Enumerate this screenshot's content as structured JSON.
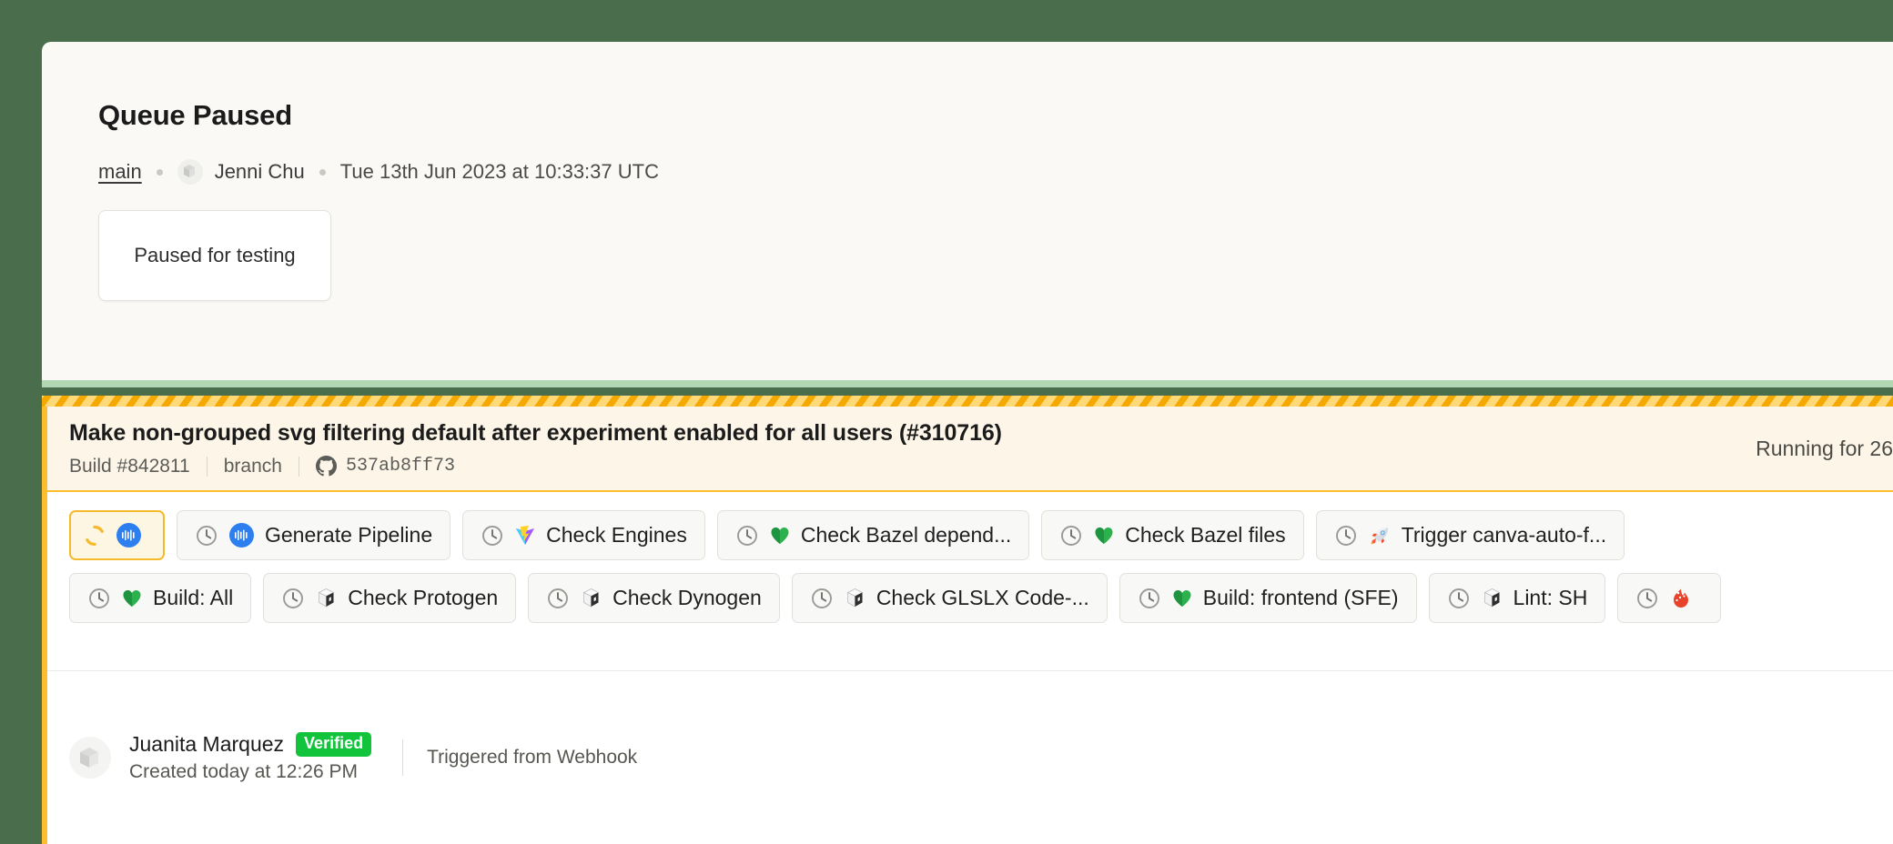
{
  "theme": {
    "page_bg": "#4a6e4c",
    "card_bg": "#faf9f5",
    "accent_yellow": "#fcbe2c",
    "stripe_dark": "#f5a800",
    "stripe_light": "#ffd977",
    "banner_bg": "#fdf6e8",
    "verified_green": "#12c43c",
    "badge_blue": "#2d7ff0"
  },
  "queue": {
    "title": "Queue Paused",
    "branch": "main",
    "user": "Jenni Chu",
    "avatar_icon": "buildkite-avatar-icon",
    "timestamp": "Tue 13th Jun 2023 at 10:33:37 UTC",
    "reason": "Paused for testing"
  },
  "build": {
    "title": "Make non-grouped svg filtering default after experiment enabled for all users (#310716)",
    "number": "Build #842811",
    "branch": "branch",
    "commit_icon": "github-icon",
    "commit": "537ab8ff73",
    "running_for": "Running for 26"
  },
  "jobs": {
    "rows": [
      [
        {
          "state": "running",
          "state_icon": "spinner-icon",
          "emoji": "buildkite-badge-icon",
          "label": ""
        },
        {
          "state": "waiting",
          "state_icon": "clock-icon",
          "emoji": "buildkite-badge-icon",
          "label": "Generate Pipeline"
        },
        {
          "state": "waiting",
          "state_icon": "clock-icon",
          "emoji": "vite-icon",
          "label": "Check Engines"
        },
        {
          "state": "waiting",
          "state_icon": "clock-icon",
          "emoji": "green-heart-icon",
          "label": "Check Bazel depend..."
        },
        {
          "state": "waiting",
          "state_icon": "clock-icon",
          "emoji": "green-heart-icon",
          "label": "Check Bazel files"
        },
        {
          "state": "waiting",
          "state_icon": "clock-icon",
          "emoji": "rocket-icon",
          "label": "Trigger canva-auto-f..."
        }
      ],
      [
        {
          "state": "waiting",
          "state_icon": "clock-icon",
          "emoji": "green-heart-icon",
          "label": "Build: All"
        },
        {
          "state": "waiting",
          "state_icon": "clock-icon",
          "emoji": "package-icon",
          "label": "Check Protogen"
        },
        {
          "state": "waiting",
          "state_icon": "clock-icon",
          "emoji": "package-icon",
          "label": "Check Dynogen"
        },
        {
          "state": "waiting",
          "state_icon": "clock-icon",
          "emoji": "package-icon",
          "label": "Check GLSLX Code-..."
        },
        {
          "state": "waiting",
          "state_icon": "clock-icon",
          "emoji": "green-heart-icon",
          "label": "Build: frontend (SFE)"
        },
        {
          "state": "waiting",
          "state_icon": "clock-icon",
          "emoji": "package-icon",
          "label": "Lint: SH"
        },
        {
          "state": "waiting",
          "state_icon": "clock-icon",
          "emoji": "fire-icon",
          "label": ""
        }
      ]
    ]
  },
  "footer": {
    "avatar_icon": "buildkite-avatar-icon",
    "name": "Juanita Marquez",
    "verified_label": "Verified",
    "created": "Created today at 12:26 PM",
    "trigger": "Triggered from Webhook"
  }
}
